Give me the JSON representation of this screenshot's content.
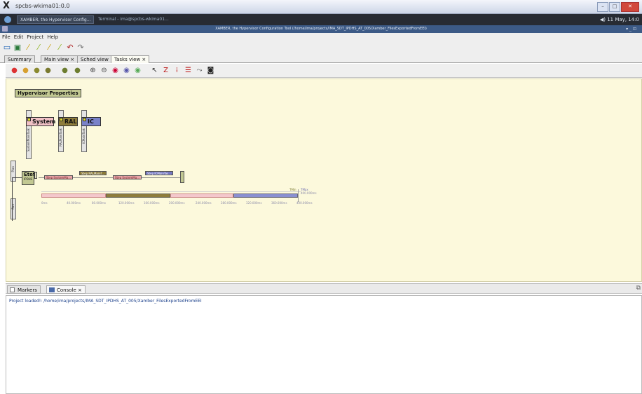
{
  "xwindow": {
    "title": "spcbs-wkima01:0.0"
  },
  "panel": {
    "tasks": [
      {
        "label": "XAMBER, the Hypervisor Config..."
      },
      {
        "label": "Terminal - ima@spcbs-wkima01..."
      }
    ],
    "clock": "11 May, 14:0"
  },
  "app": {
    "title": "XAMBER, the Hypervisor Configuration Tool (/home/ima/projects/IMA_SDT_IPDHS_AT_005/Xamber_FilesExportedFromEEI)"
  },
  "menubar": {
    "items": [
      "File",
      "Edit",
      "Project",
      "Help"
    ]
  },
  "toolbar": {
    "icons": [
      "new-icon",
      "save-icon",
      "wand-icon",
      "wand-icon",
      "wand-icon",
      "wand-icon",
      "undo-icon",
      "redo-icon"
    ]
  },
  "tabs": [
    {
      "label": "Summary"
    },
    {
      "label": "Main view ×"
    },
    {
      "label": "Sched view"
    },
    {
      "label": "Tasks view ×"
    }
  ],
  "canvas": {
    "hypervisor_label": "Hypervisor Properties",
    "partitions": [
      {
        "name": "System",
        "task_lane": "SystemMainTask",
        "color": "#f1c1c6"
      },
      {
        "name": "RAL",
        "task_lane": "RALMainTask",
        "color": "#8e7d3c"
      },
      {
        "name": "IC",
        "task_lane": "ICMainTask",
        "color": "#7a82c9"
      }
    ],
    "left_lanes": {
      "top": "Plan",
      "bottom": "Run"
    },
    "etef": {
      "name": "Etef",
      "sub": "IPDHS"
    },
    "steps": [
      {
        "label": "Step SystemMa...",
        "color": "#e8a6a8"
      },
      {
        "label": "Step RALMainT...",
        "color": "#8a7a38"
      },
      {
        "label": "Step SystemMa...",
        "color": "#e8a6a8"
      },
      {
        "label": "Step ICMainTas...",
        "color": "#7578c2"
      }
    ],
    "timeline_marker": {
      "label": "TMin",
      "label2": "TMax",
      "value": "400.000ms"
    },
    "ticks": [
      "0ms",
      "40.000ms",
      "80.000ms",
      "120.000ms",
      "160.000ms",
      "200.000ms",
      "240.000ms",
      "280.000ms",
      "320.000ms",
      "360.000ms",
      "400.000ms"
    ]
  },
  "bottom": {
    "tabs": [
      {
        "label": "Markers"
      },
      {
        "label": "Console ×"
      }
    ],
    "console_line": "Project loaded!: /home/ima/projects/IMA_SDT_IPDHS_AT_005/Xamber_FilesExportedFromEEI"
  }
}
